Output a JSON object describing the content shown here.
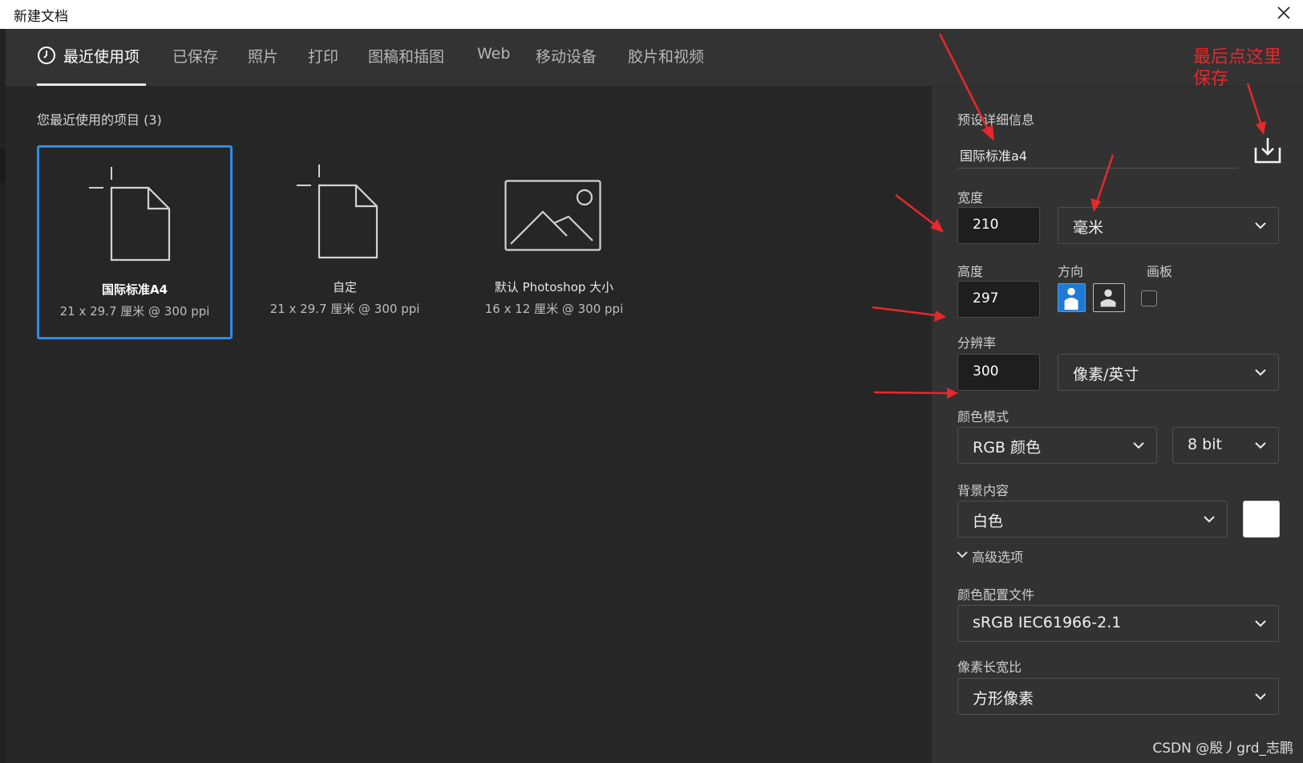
{
  "window": {
    "title": "新建文档"
  },
  "tabs": [
    "最近使用项",
    "已保存",
    "照片",
    "打印",
    "图稿和插图",
    "Web",
    "移动设备",
    "胶片和视频"
  ],
  "recent": {
    "heading": "您最近使用的项目 (3)",
    "items": [
      {
        "name": "国际标准A4",
        "sub": "21 x 29.7 厘米 @ 300 ppi",
        "icon": "blank-document-icon",
        "selected": true
      },
      {
        "name": "自定",
        "sub": "21 x 29.7 厘米 @ 300 ppi",
        "icon": "blank-document-icon",
        "selected": false
      },
      {
        "name": "默认 Photoshop 大小",
        "sub": "16 x 12 厘米 @ 300 ppi",
        "icon": "image-icon",
        "selected": false
      }
    ]
  },
  "details": {
    "heading": "预设详细信息",
    "preset_name": "国际标准a4",
    "width_label": "宽度",
    "width_value": "210",
    "width_unit": "毫米",
    "height_label": "高度",
    "height_value": "297",
    "orientation_label": "方向",
    "artboard_label": "画板",
    "resolution_label": "分辨率",
    "resolution_value": "300",
    "resolution_unit": "像素/英寸",
    "color_mode_label": "颜色模式",
    "color_mode": "RGB 颜色",
    "bit_depth": "8 bit",
    "background_label": "背景内容",
    "background": "白色",
    "advanced_label": "高级选项",
    "color_profile_label": "颜色配置文件",
    "color_profile": "sRGB IEC61966-2.1",
    "pixel_aspect_label": "像素长宽比",
    "pixel_aspect": "方形像素"
  },
  "annotation": {
    "line1": "最后点这里",
    "line2": "保存"
  },
  "watermark": "CSDN @殷丿grd_志鹏",
  "colors": {
    "accent": "#2d8ceb",
    "annotation_red": "#e8282a",
    "panel": "#323232",
    "main": "#262626",
    "tabbar": "#333333"
  }
}
